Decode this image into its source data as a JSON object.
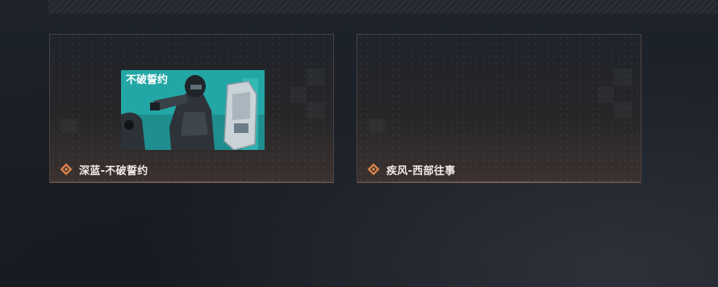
{
  "cards": [
    {
      "label": "深蓝-不破誓约",
      "has_thumbnail": true,
      "thumbnail_title": "不破誓约"
    },
    {
      "label": "疾风-西部往事",
      "has_thumbnail": false
    }
  ],
  "colors": {
    "accent": "#d9824a",
    "card_border": "#4e4440",
    "background": "#1b1f27",
    "label_text": "#f1ebe6"
  }
}
